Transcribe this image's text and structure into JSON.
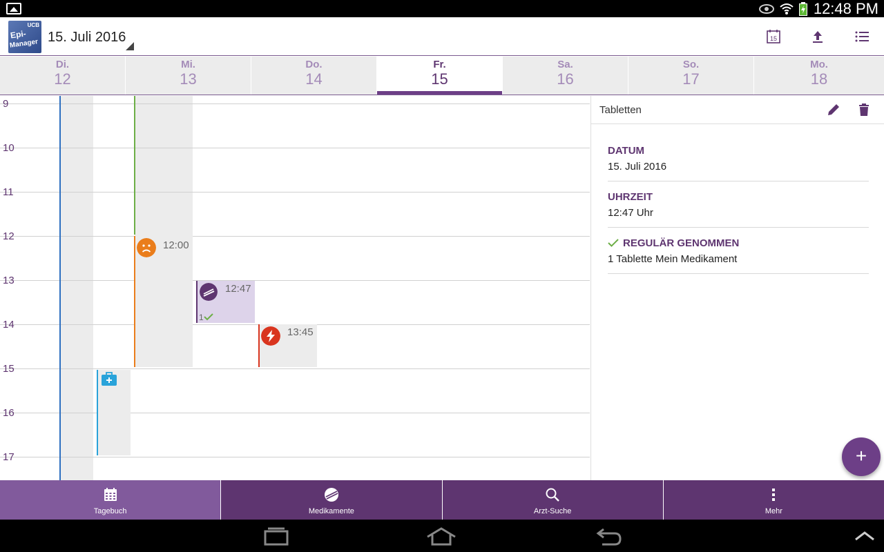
{
  "statusbar": {
    "time": "12:48 PM"
  },
  "appbar": {
    "logo_top": "UCB",
    "logo_line1": "Epi-",
    "logo_line2": "Manager",
    "date_title": "15. Juli 2016",
    "calendar_icon_day": "15"
  },
  "days": [
    {
      "name": "Di.",
      "num": "12",
      "selected": false
    },
    {
      "name": "Mi.",
      "num": "13",
      "selected": false
    },
    {
      "name": "Do.",
      "num": "14",
      "selected": false
    },
    {
      "name": "Fr.",
      "num": "15",
      "selected": true
    },
    {
      "name": "Sa.",
      "num": "16",
      "selected": false
    },
    {
      "name": "So.",
      "num": "17",
      "selected": false
    },
    {
      "name": "Mo.",
      "num": "18",
      "selected": false
    }
  ],
  "calendar": {
    "hours": [
      "9",
      "10",
      "11",
      "12",
      "13",
      "14",
      "15",
      "16",
      "17"
    ],
    "events": {
      "mood_time": "12:00",
      "med_time": "12:47",
      "med_count": "1",
      "seizure_time": "13:45"
    }
  },
  "detail": {
    "title": "Tabletten",
    "datum_label": "DATUM",
    "datum_value": "15. Juli 2016",
    "uhrzeit_label": "UHRZEIT",
    "uhrzeit_value": "12:47 Uhr",
    "status_label": "REGULÄR GENOMMEN",
    "status_value": "1 Tablette Mein Medikament"
  },
  "fab": {
    "label": "+"
  },
  "bottomnav": [
    {
      "label": "Tagebuch",
      "icon": "calendar-grid-icon",
      "active": true
    },
    {
      "label": "Medikamente",
      "icon": "pill-icon",
      "active": false
    },
    {
      "label": "Arzt-Suche",
      "icon": "search-icon",
      "active": false
    },
    {
      "label": "Mehr",
      "icon": "more-vert-icon",
      "active": false
    }
  ],
  "colors": {
    "primary": "#5e3570",
    "active_nav": "#815a9c",
    "mood": "#ea7d1b",
    "seizure": "#d9351f",
    "doctor": "#29a3da",
    "blue_line": "#2d6fc0",
    "green_line": "#6cae46"
  }
}
